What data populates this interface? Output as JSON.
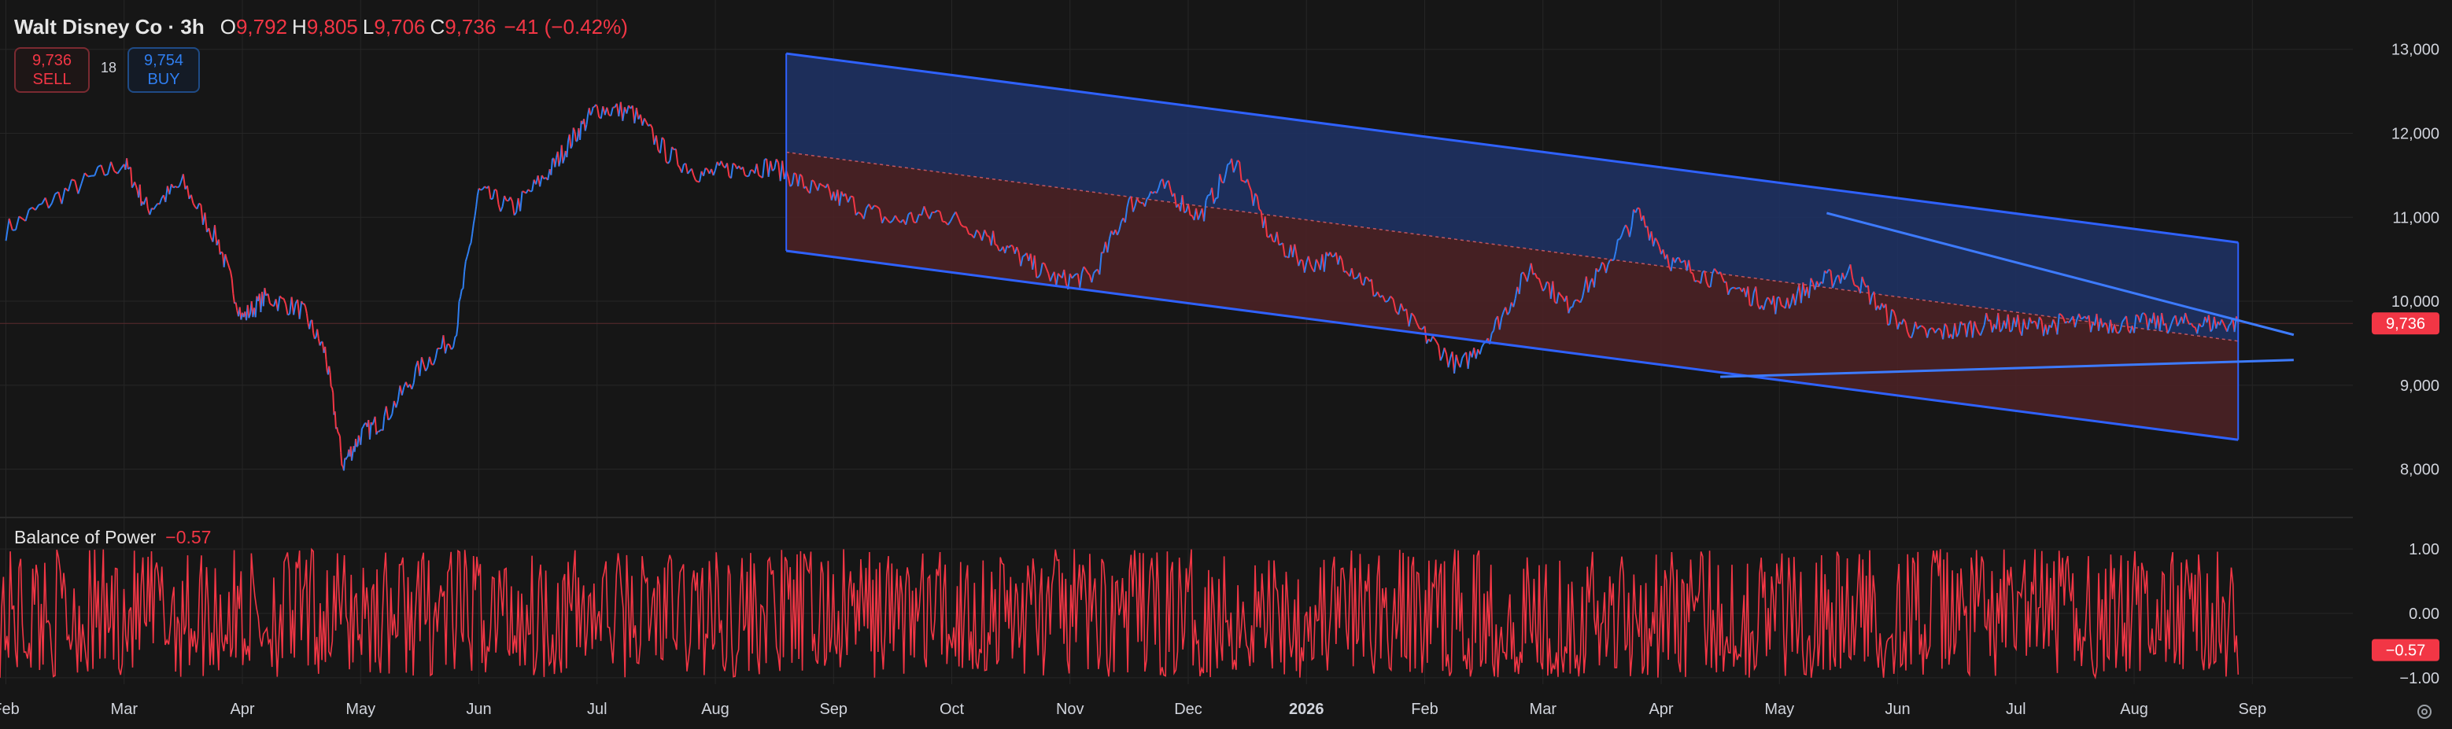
{
  "header": {
    "symbol": "Walt Disney Co · 3h",
    "open_key": "O",
    "open": "9,792",
    "high_key": "H",
    "high": "9,805",
    "low_key": "L",
    "low": "9,706",
    "close_key": "C",
    "close": "9,736",
    "change": "−41 (−0.42%)"
  },
  "trade": {
    "sell_price": "9,736",
    "sell_label": "SELL",
    "spread": "18",
    "buy_price": "9,754",
    "buy_label": "BUY"
  },
  "indicator": {
    "name": "Balance of Power",
    "value": "−0.57"
  },
  "colors": {
    "background": "#161616",
    "grid": "#262626",
    "up": "#2f7ef0",
    "down": "#f23645",
    "channel_line": "#2f62ff",
    "upper_zone": "#1e3266",
    "lower_zone": "#4d2226",
    "bop_line": "#f23645"
  },
  "icons": {
    "settings": "gear-icon"
  },
  "chart_data": [
    {
      "type": "line",
      "title": "Walt Disney Co · 3h",
      "price_axis": {
        "ticks": [
          8000,
          9000,
          10000,
          11000,
          12000,
          13000
        ],
        "tick_labels": [
          "8,000",
          "9,000",
          "10,000",
          "11,000",
          "12,000",
          "13,000"
        ],
        "ylim": [
          7500,
          13400
        ]
      },
      "time_axis": {
        "labels": [
          "Feb",
          "Mar",
          "Apr",
          "May",
          "Jun",
          "Jul",
          "Aug",
          "Sep",
          "Oct",
          "Nov",
          "Dec",
          "2026",
          "Feb",
          "Mar",
          "Apr",
          "May",
          "Jun",
          "Jul",
          "Aug",
          "Sep"
        ],
        "xlim": [
          -0.05,
          19.85
        ]
      },
      "current_price": 9736,
      "current_price_label": "9,736",
      "series": [
        {
          "x": [
            0.0,
            0.5,
            1.0,
            1.2,
            1.5,
            1.8,
            2.0,
            2.2,
            2.5,
            2.7,
            2.85,
            3.0,
            3.2,
            3.5,
            3.8,
            4.0,
            4.3,
            4.6,
            4.8,
            5.0,
            5.3,
            5.6,
            5.9,
            6.2,
            6.5,
            6.8,
            7.1,
            7.5,
            7.9,
            8.3,
            8.6,
            8.9,
            9.2,
            9.5,
            9.8,
            10.1,
            10.4,
            10.7,
            11.0,
            11.3,
            11.6,
            12.0,
            12.3,
            12.6,
            12.9,
            13.2,
            13.5,
            13.8,
            14.1,
            14.4,
            14.7,
            15.0,
            15.3,
            15.6,
            15.9,
            16.2,
            16.5,
            16.8,
            17.1,
            17.4,
            17.7,
            18.0,
            18.3,
            18.6,
            18.88
          ],
          "y": [
            10850,
            11300,
            11650,
            11100,
            11400,
            10700,
            9800,
            10050,
            9900,
            9400,
            8050,
            8400,
            8600,
            9200,
            9600,
            11300,
            11100,
            11550,
            11950,
            12300,
            12250,
            11750,
            11500,
            11600,
            11600,
            11350,
            11200,
            10950,
            11050,
            10800,
            10500,
            10250,
            10300,
            11150,
            11350,
            11000,
            11700,
            10750,
            10450,
            10500,
            10100,
            9600,
            9200,
            9700,
            10400,
            9950,
            10350,
            11050,
            10450,
            10300,
            10100,
            9950,
            10200,
            10350,
            9850,
            9600,
            9650,
            9750,
            9700,
            9736,
            9736,
            9736,
            9736,
            9736,
            9736
          ]
        }
      ],
      "channel": {
        "upper": {
          "x": [
            6.6,
            18.88
          ],
          "y": [
            12950,
            10700
          ]
        },
        "lower": {
          "x": [
            6.6,
            18.88
          ],
          "y": [
            10600,
            8350
          ]
        },
        "mid": {
          "x": [
            6.6,
            18.88
          ],
          "y": [
            11775,
            9525
          ]
        }
      },
      "trendlines": [
        {
          "x": [
            15.4,
            19.35
          ],
          "y": [
            11050,
            9600
          ]
        },
        {
          "x": [
            14.5,
            19.35
          ],
          "y": [
            9100,
            9300
          ]
        }
      ]
    },
    {
      "type": "line",
      "title": "Balance of Power",
      "ylim": [
        -1.1,
        1.1
      ],
      "ticks": [
        -1,
        0,
        1
      ],
      "tick_labels": [
        "−1.00",
        "0.00",
        "1.00"
      ],
      "current_value": -0.57,
      "current_value_label": "−0.57"
    }
  ]
}
